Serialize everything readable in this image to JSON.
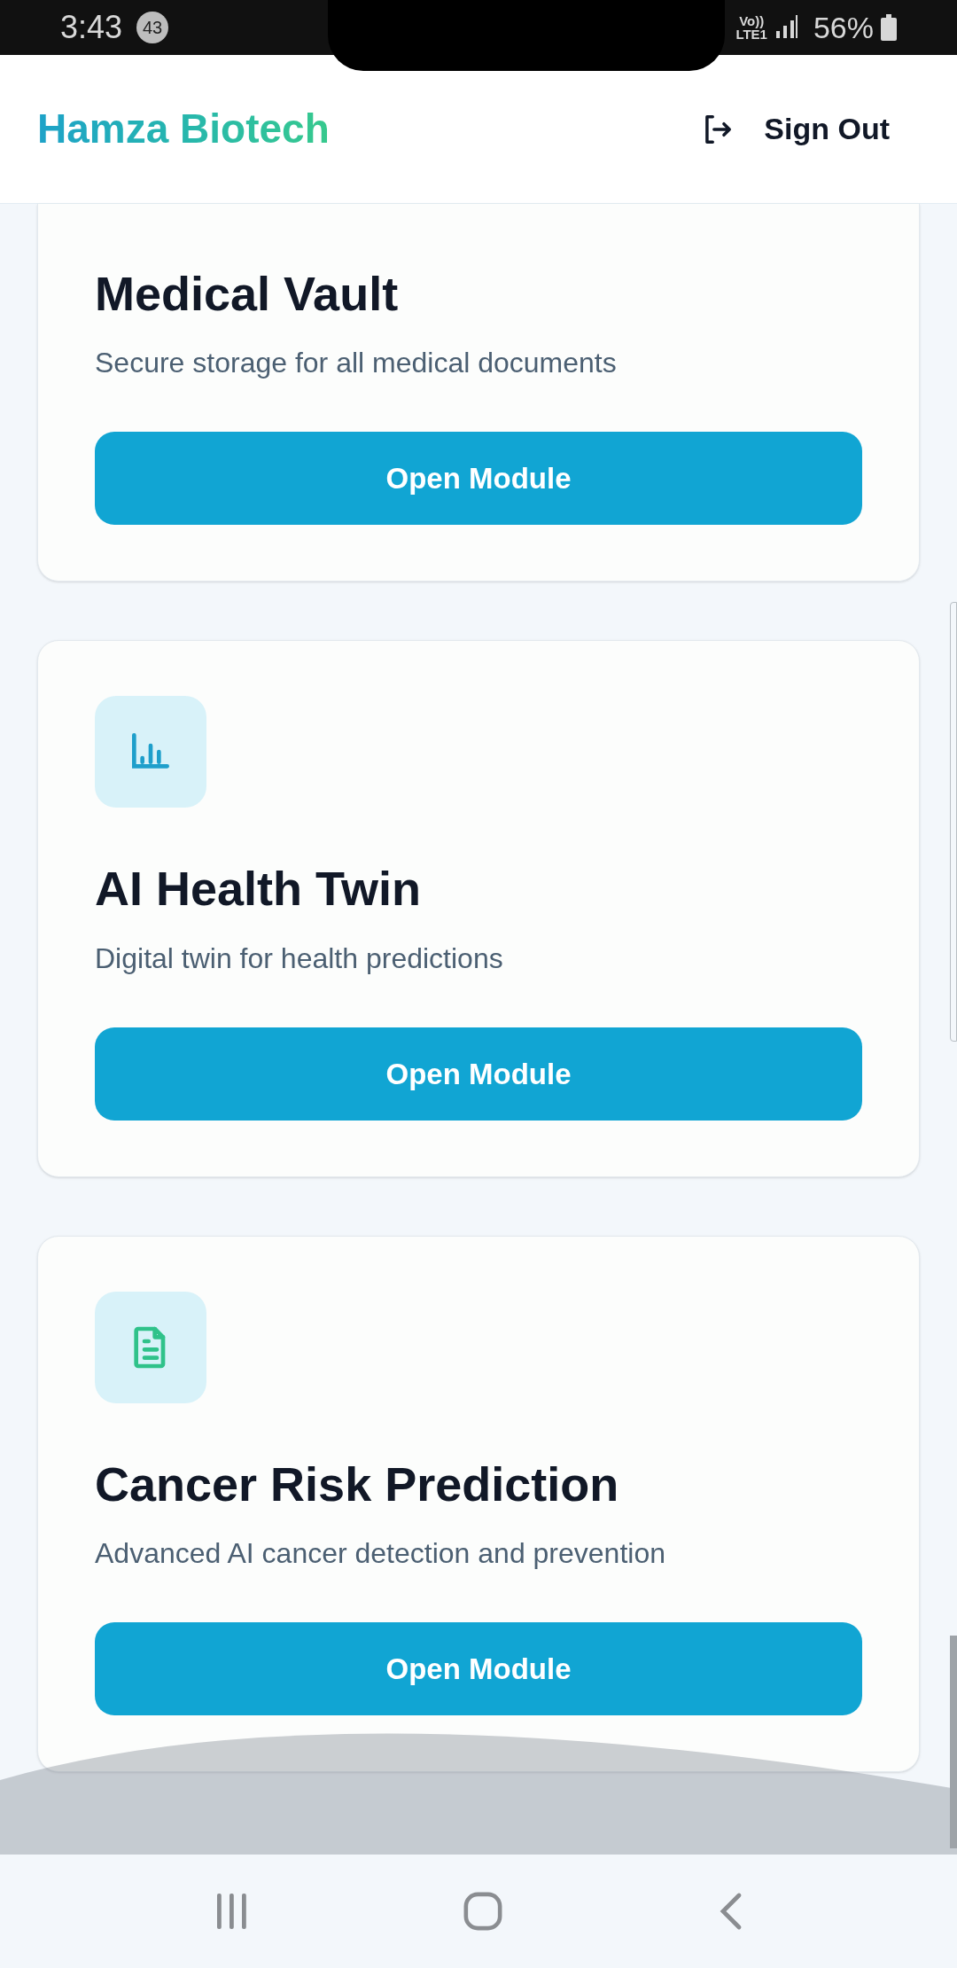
{
  "status_bar": {
    "time": "3:43",
    "notification_count": "43",
    "volte": "Vo))",
    "network": "LTE1",
    "battery": "56%"
  },
  "header": {
    "brand": "Hamza Biotech",
    "sign_out": "Sign Out"
  },
  "modules": [
    {
      "title": "Medical Vault",
      "description": "Secure storage for all medical documents",
      "button": "Open Module"
    },
    {
      "kind": "chart",
      "title": "AI Health Twin",
      "description": "Digital twin for health predictions",
      "button": "Open Module"
    },
    {
      "kind": "document",
      "title": "Cancer Risk Prediction",
      "description": "Advanced AI cancer detection and prevention",
      "button": "Open Module"
    }
  ]
}
